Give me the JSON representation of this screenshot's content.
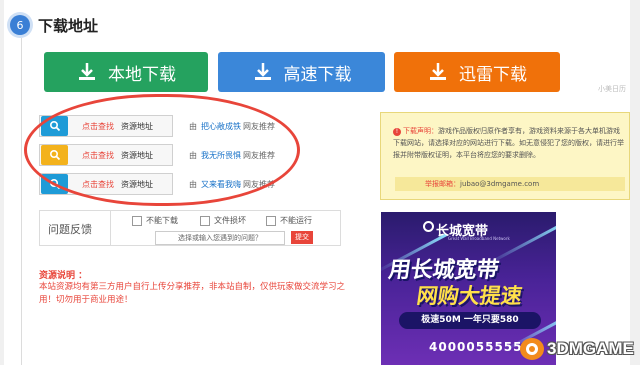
{
  "section": {
    "number": "6",
    "title": "下载地址"
  },
  "buttons": {
    "local": "本地下载",
    "fast": "高速下载",
    "xunlei": "迅雷下载"
  },
  "watermark": "小美日历",
  "download_rows": [
    {
      "icon": "search-icon",
      "icon_color": "#1e9bd7",
      "click": "点击查找",
      "resource": "资源地址",
      "by": "由",
      "name": "把心敞成铁",
      "rec": "网友推荐"
    },
    {
      "icon": "search-icon",
      "icon_color": "#f3b21c",
      "click": "点击查找",
      "resource": "资源地址",
      "by": "由",
      "name": "我无所畏惧",
      "rec": "网友推荐"
    },
    {
      "icon": "search-icon",
      "icon_color": "#1e9bd7",
      "click": "点击查找",
      "resource": "资源地址",
      "by": "由",
      "name": "又来看我嗨",
      "rec": "网友推荐"
    }
  ],
  "feedback": {
    "label": "问题反馈",
    "options": [
      "不能下载",
      "文件损坏",
      "不能运行"
    ],
    "placeholder": "选择或输入您遇到的问题？",
    "submit": "提交"
  },
  "notes": {
    "title": "资源说明 ：",
    "body": "本站资源均有第三方用户自行上传分享推荐，非本站自制，仅供玩家做交流学习之用！切勿用于商业用途！"
  },
  "disclaimer": {
    "head": "下载声明：",
    "text": "游戏作品版权归原作者享有，游戏资料来源于各大单机游戏下载网站，请选择对应的网站进行下载。如无意侵犯了您的版权，请进行举报并附带版权证明，本平台将应您的要求删除。",
    "report_label": "举报邮箱：",
    "report_email": "jubao@3dmgame.com"
  },
  "ad": {
    "brand": "长城宽带",
    "brand_sub": "Great Wall Broadband Network",
    "headline1": "用长城宽带",
    "headline2": "网购大提速",
    "pill": "极速50M 一年只要580",
    "number": "4000055555"
  },
  "logo": {
    "text": "3DMGAME"
  },
  "colors": {
    "green": "#25a25f",
    "blue": "#3b87d9",
    "orange": "#f0710a",
    "red": "#e8453a"
  }
}
